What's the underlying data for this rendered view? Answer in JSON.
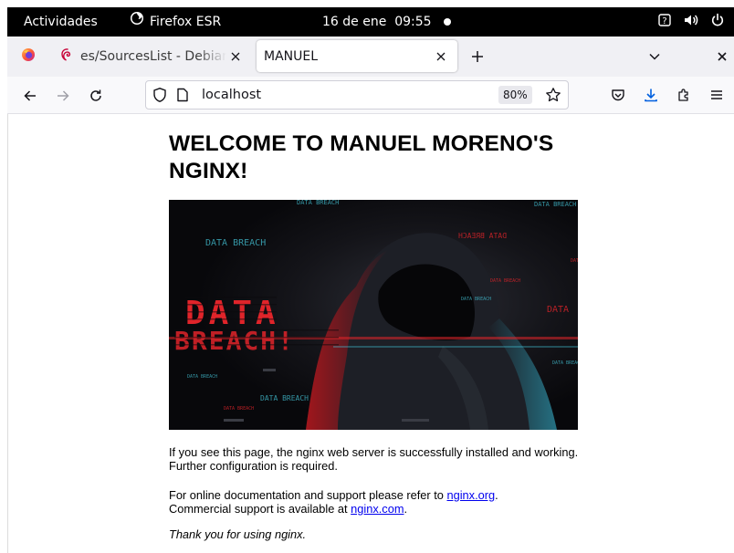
{
  "topbar": {
    "activities": "Actividades",
    "app_name": "Firefox ESR",
    "date": "16 de ene",
    "time": "09:55"
  },
  "tabs": {
    "debian_title": "es/SourcesList - Debian Wiki",
    "active_title": "MANUEL"
  },
  "navbar": {
    "url": "localhost",
    "zoom": "80%"
  },
  "page": {
    "heading": "WELCOME TO MANUEL MORENO'S NGINX!",
    "hero_text": {
      "data": "DATA",
      "breach": "BREACH!",
      "tag": "DATA BREACH",
      "mirror": "DATA BREACH"
    },
    "para1": "If you see this page, the nginx web server is successfully installed and working. Further configuration is required.",
    "para2_prefix": "For online documentation and support please refer to ",
    "para2_link": "nginx.org",
    "para2_mid": ".",
    "para2_line2": "Commercial support is available at ",
    "para2_link2": "nginx.com",
    "para2_end": ".",
    "thanks": "Thank you for using nginx."
  },
  "colors": {
    "accent_download": "#0060df",
    "link": "#0000ee",
    "hero_red": "#e0242a",
    "hero_cyan": "#43c3d6"
  },
  "icons": [
    "firefox-icon",
    "debian-swirl-icon",
    "close-icon",
    "plus-icon",
    "chevron-down-icon",
    "back-arrow-icon",
    "forward-arrow-icon",
    "reload-icon",
    "shield-icon",
    "page-icon",
    "bookmark-star-icon",
    "pocket-icon",
    "download-icon",
    "extensions-icon",
    "hamburger-menu-icon",
    "accessibility-icon",
    "volume-icon",
    "power-icon"
  ]
}
